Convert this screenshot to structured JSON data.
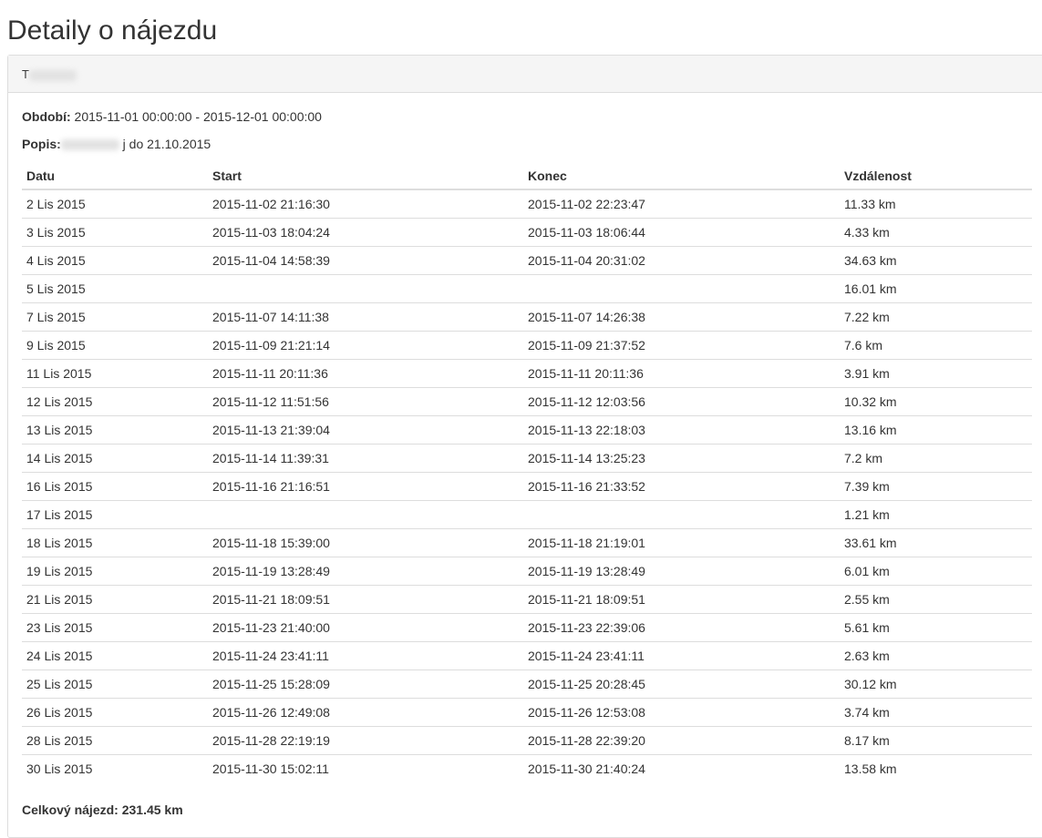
{
  "page": {
    "title": "Detaily o nájezdu"
  },
  "panel": {
    "heading_visible": "T"
  },
  "info": {
    "period_label": "Období:",
    "period_value": "2015-11-01 00:00:00 - 2015-12-01 00:00:00",
    "description_label": "Popis:",
    "description_visible": "j do 21.10.2015"
  },
  "table": {
    "headers": [
      "Datu",
      "Start",
      "Konec",
      "Vzdálenost"
    ],
    "rows": [
      [
        "2 Lis 2015",
        "2015-11-02 21:16:30",
        "2015-11-02 22:23:47",
        "11.33 km"
      ],
      [
        "3 Lis 2015",
        "2015-11-03 18:04:24",
        "2015-11-03 18:06:44",
        "4.33 km"
      ],
      [
        "4 Lis 2015",
        "2015-11-04 14:58:39",
        "2015-11-04 20:31:02",
        "34.63 km"
      ],
      [
        "5 Lis 2015",
        "",
        "",
        "16.01 km"
      ],
      [
        "7 Lis 2015",
        "2015-11-07 14:11:38",
        "2015-11-07 14:26:38",
        "7.22 km"
      ],
      [
        "9 Lis 2015",
        "2015-11-09 21:21:14",
        "2015-11-09 21:37:52",
        "7.6 km"
      ],
      [
        "11 Lis 2015",
        "2015-11-11 20:11:36",
        "2015-11-11 20:11:36",
        "3.91 km"
      ],
      [
        "12 Lis 2015",
        "2015-11-12 11:51:56",
        "2015-11-12 12:03:56",
        "10.32 km"
      ],
      [
        "13 Lis 2015",
        "2015-11-13 21:39:04",
        "2015-11-13 22:18:03",
        "13.16 km"
      ],
      [
        "14 Lis 2015",
        "2015-11-14 11:39:31",
        "2015-11-14 13:25:23",
        "7.2 km"
      ],
      [
        "16 Lis 2015",
        "2015-11-16 21:16:51",
        "2015-11-16 21:33:52",
        "7.39 km"
      ],
      [
        "17 Lis 2015",
        "",
        "",
        "1.21 km"
      ],
      [
        "18 Lis 2015",
        "2015-11-18 15:39:00",
        "2015-11-18 21:19:01",
        "33.61 km"
      ],
      [
        "19 Lis 2015",
        "2015-11-19 13:28:49",
        "2015-11-19 13:28:49",
        "6.01 km"
      ],
      [
        "21 Lis 2015",
        "2015-11-21 18:09:51",
        "2015-11-21 18:09:51",
        "2.55 km"
      ],
      [
        "23 Lis 2015",
        "2015-11-23 21:40:00",
        "2015-11-23 22:39:06",
        "5.61 km"
      ],
      [
        "24 Lis 2015",
        "2015-11-24 23:41:11",
        "2015-11-24 23:41:11",
        "2.63 km"
      ],
      [
        "25 Lis 2015",
        "2015-11-25 15:28:09",
        "2015-11-25 20:28:45",
        "30.12 km"
      ],
      [
        "26 Lis 2015",
        "2015-11-26 12:49:08",
        "2015-11-26 12:53:08",
        "3.74 km"
      ],
      [
        "28 Lis 2015",
        "2015-11-28 22:19:19",
        "2015-11-28 22:39:20",
        "8.17 km"
      ],
      [
        "30 Lis 2015",
        "2015-11-30 15:02:11",
        "2015-11-30 21:40:24",
        "13.58 km"
      ]
    ]
  },
  "footer": {
    "total_label": "Celkový nájezd:",
    "total_value": "231.45 km"
  }
}
